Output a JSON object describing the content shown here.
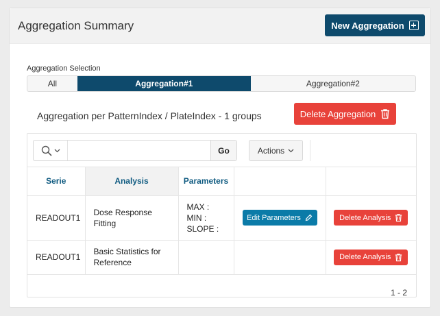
{
  "header": {
    "title": "Aggregation Summary",
    "new_button_label": "New Aggregation",
    "new_button_icon": "plus-square-icon"
  },
  "aggregation_selection": {
    "label": "Aggregation Selection",
    "options": [
      "All",
      "Aggregation#1",
      "Aggregation#2"
    ],
    "selected": "Aggregation#1"
  },
  "aggregation": {
    "title": "Aggregation per PatternIndex / PlateIndex - 1 groups",
    "delete_label": "Delete Aggregation",
    "delete_icon": "trash-icon"
  },
  "toolbar": {
    "search_icon": "search-icon",
    "search_value": "",
    "search_placeholder": "",
    "go_label": "Go",
    "actions_label": "Actions"
  },
  "table": {
    "columns": [
      "Serie",
      "Analysis",
      "Parameters",
      "",
      ""
    ],
    "rows": [
      {
        "serie": "READOUT1",
        "analysis": "Dose Response Fitting",
        "parameters": [
          "MAX :",
          "MIN :",
          "SLOPE :"
        ],
        "edit_label": "Edit Parameters",
        "delete_label": "Delete Analysis"
      },
      {
        "serie": "READOUT1",
        "analysis": "Basic Statistics for Reference",
        "parameters": [],
        "edit_label": "",
        "delete_label": "Delete Analysis"
      }
    ]
  },
  "pagination": "1 - 2",
  "colors": {
    "primary": "#0e4a6c",
    "danger": "#e8423a",
    "edit": "#0b7ba8",
    "header_text": "#0e5a80"
  }
}
